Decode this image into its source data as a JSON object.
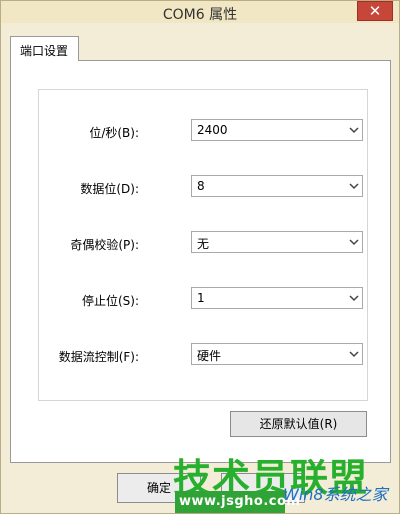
{
  "window": {
    "title": "COM6 属性",
    "close_glyph": "✕"
  },
  "tabs": [
    {
      "label": "端口设置",
      "active": true
    }
  ],
  "fields": [
    {
      "label": "位/秒(B):",
      "value": "2400"
    },
    {
      "label": "数据位(D):",
      "value": "8"
    },
    {
      "label": "奇偶校验(P):",
      "value": "无"
    },
    {
      "label": "停止位(S):",
      "value": "1"
    },
    {
      "label": "数据流控制(F):",
      "value": "硬件"
    }
  ],
  "buttons": {
    "restore_defaults": "还原默认值(R)",
    "ok": "确定"
  },
  "watermark": {
    "main": "技术员联盟",
    "url": "www.jsgho.com",
    "logo": "Win8系统之家"
  },
  "colors": {
    "close_button": "#c7463a",
    "watermark_green": "#27b02d",
    "watermark_blue": "#1f6fc3"
  }
}
